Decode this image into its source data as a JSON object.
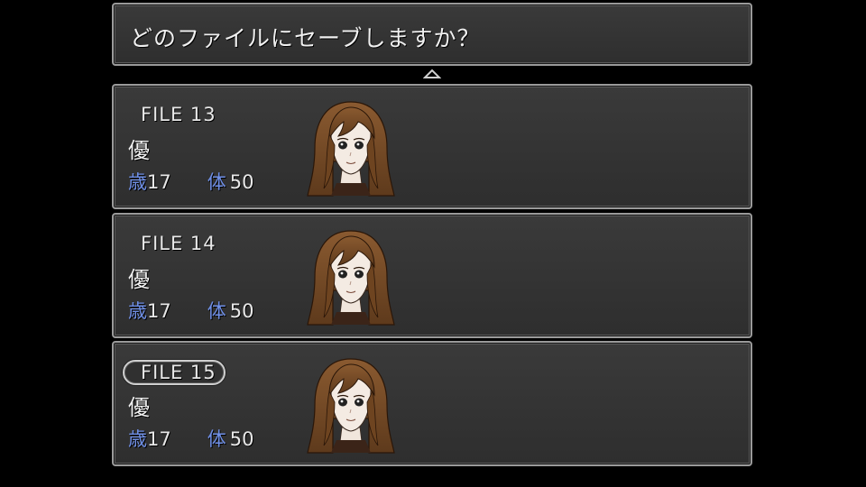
{
  "prompt": {
    "text": "どのファイルにセーブしますか？"
  },
  "scroll_indicator": "scroll-up-arrow",
  "slots": [
    {
      "file_label": "FILE 13",
      "name": "優",
      "age_label": "歳",
      "age": "17",
      "stamina_label": "体",
      "stamina": "50",
      "portrait": "character-portrait",
      "selected": false
    },
    {
      "file_label": "FILE 14",
      "name": "優",
      "age_label": "歳",
      "age": "17",
      "stamina_label": "体",
      "stamina": "50",
      "portrait": "character-portrait",
      "selected": false
    },
    {
      "file_label": "FILE 15",
      "name": "優",
      "age_label": "歳",
      "age": "17",
      "stamina_label": "体",
      "stamina": "50",
      "portrait": "character-portrait",
      "selected": true
    }
  ],
  "colors": {
    "window_bg": "#333333",
    "window_border": "#9a9a9a",
    "stat_label": "#6f8fe6",
    "text": "#e8e8e8"
  }
}
